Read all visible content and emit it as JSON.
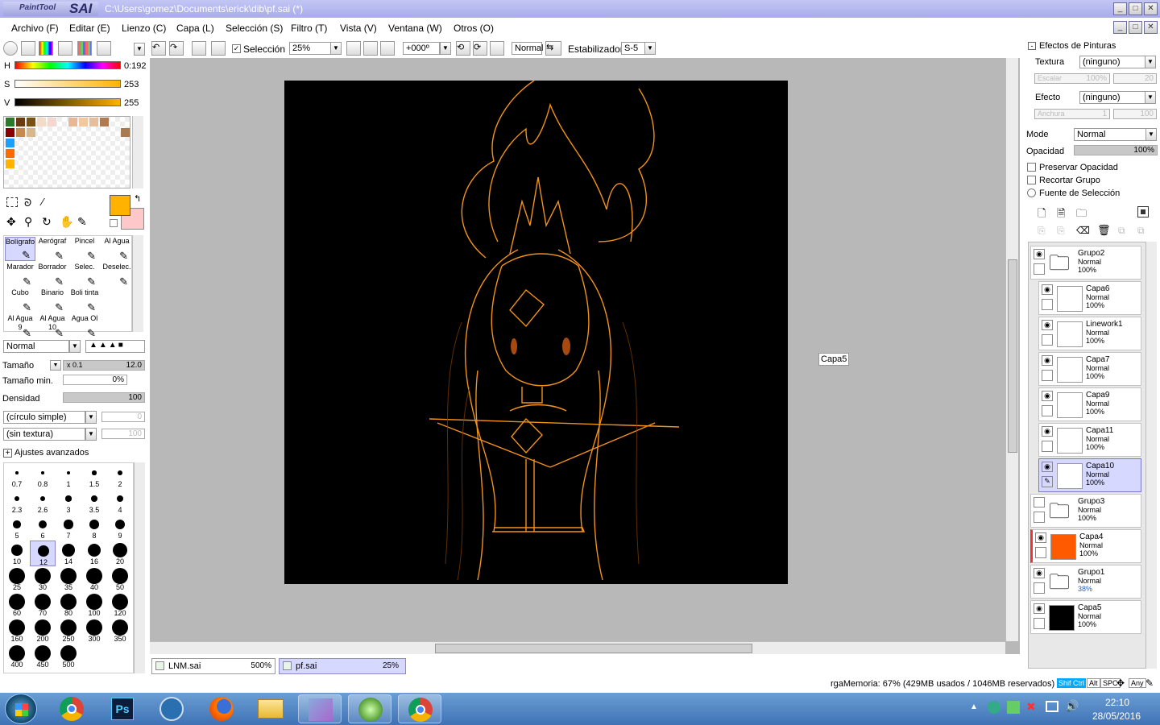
{
  "app": {
    "logo_small": "PaintTool",
    "logo_big": "SAI",
    "window_title": "C:\\Users\\gomez\\Documents\\erick\\dib\\pf.sai (*)"
  },
  "menu": [
    "Archivo (F)",
    "Editar (E)",
    "Lienzo (C)",
    "Capa (L)",
    "Selección (S)",
    "Filtro (T)",
    "Vista (V)",
    "Ventana (W)",
    "Otros (O)"
  ],
  "toolbar": {
    "selection_label": "Selección",
    "zoom": "25%",
    "angle": "+000º",
    "blend": "Normal",
    "stabilizer_label": "Estabilizador",
    "stabilizer_value": "S-5"
  },
  "color": {
    "h_label": "H",
    "h_value": "0:192",
    "s_label": "S",
    "s_value": "253",
    "v_label": "V",
    "v_value": "255",
    "primary": "#ffb300",
    "secondary": "#ffc8c8"
  },
  "tools": [
    {
      "name": "Bolígrafo",
      "selected": true
    },
    {
      "name": "Aerógraf",
      "selected": false
    },
    {
      "name": "Pincel",
      "selected": false
    },
    {
      "name": "Al Agua",
      "selected": false
    },
    {
      "name": "Marador",
      "selected": false
    },
    {
      "name": "Borrador",
      "selected": false
    },
    {
      "name": "Selec.",
      "selected": false
    },
    {
      "name": "Deselec.",
      "selected": false
    },
    {
      "name": "Cubo",
      "selected": false
    },
    {
      "name": "Binario",
      "selected": false
    },
    {
      "name": "Boli tinta",
      "selected": false
    },
    {
      "name": "",
      "selected": false
    },
    {
      "name": "Al Agua 9",
      "selected": false
    },
    {
      "name": "Al Agua 10",
      "selected": false
    },
    {
      "name": "Agua Ol",
      "selected": false
    },
    {
      "name": "",
      "selected": false
    }
  ],
  "brush": {
    "mode": "Normal",
    "size_label": "Tamaño",
    "size_mult": "x 0.1",
    "size_value": "12.0",
    "min_size_label": "Tamaño min.",
    "min_size_value": "0%",
    "density_label": "Densidad",
    "density_value": "100",
    "shape": "(círculo simple)",
    "shape_value": "0",
    "texture": "(sin textura)",
    "texture_value": "100",
    "advanced_label": "Ajustes avanzados"
  },
  "brush_sizes": [
    "0.7",
    "0.8",
    "1",
    "1.5",
    "2",
    "2.3",
    "2.6",
    "3",
    "3.5",
    "4",
    "5",
    "6",
    "7",
    "8",
    "9",
    "10",
    "12",
    "14",
    "16",
    "20",
    "25",
    "30",
    "35",
    "40",
    "50",
    "60",
    "70",
    "80",
    "100",
    "120",
    "160",
    "200",
    "250",
    "300",
    "350",
    "400",
    "450",
    "500"
  ],
  "canvas": {
    "floating_label": "Capa5",
    "tabs": [
      {
        "name": "LNM.sai",
        "zoom": "500%"
      },
      {
        "name": "pf.sai",
        "zoom": "25%"
      }
    ]
  },
  "effects": {
    "title": "Efectos de Pinturas",
    "texture_label": "Textura",
    "texture_value": "(ninguno)",
    "scale_label": "Escalar",
    "scale_value": "100%",
    "scale_num": "20",
    "effect_label": "Efecto",
    "effect_value": "(ninguno)",
    "width_label": "Anchura",
    "width_value": "1",
    "width_num": "100"
  },
  "layer_props": {
    "mode_label": "Mode",
    "mode_value": "Normal",
    "opacity_label": "Opacidad",
    "opacity_value": "100%",
    "preserve_label": "Preservar Opacidad",
    "clip_label": "Recortar Grupo",
    "selsource_label": "Fuente de Selección"
  },
  "layers": [
    {
      "name": "Grupo2",
      "mode": "Normal",
      "opacity": "100%",
      "folder": true,
      "indent": false,
      "visible": true,
      "selected": false,
      "thumb": "#ffffff"
    },
    {
      "name": "Capa6",
      "mode": "Normal",
      "opacity": "100%",
      "folder": false,
      "indent": true,
      "visible": true,
      "selected": false,
      "thumb": "#ffffff"
    },
    {
      "name": "Linework1",
      "mode": "Normal",
      "opacity": "100%",
      "folder": false,
      "indent": true,
      "visible": true,
      "selected": false,
      "thumb": "#ffffff"
    },
    {
      "name": "Capa7",
      "mode": "Normal",
      "opacity": "100%",
      "folder": false,
      "indent": true,
      "visible": true,
      "selected": false,
      "thumb": "#ffffff"
    },
    {
      "name": "Capa9",
      "mode": "Normal",
      "opacity": "100%",
      "folder": false,
      "indent": true,
      "visible": true,
      "selected": false,
      "thumb": "#ffffff"
    },
    {
      "name": "Capa11",
      "mode": "Normal",
      "opacity": "100%",
      "folder": false,
      "indent": true,
      "visible": true,
      "selected": false,
      "thumb": "#ffffff"
    },
    {
      "name": "Capa10",
      "mode": "Normal",
      "opacity": "100%",
      "folder": false,
      "indent": true,
      "visible": true,
      "selected": true,
      "thumb": "#ffffff"
    },
    {
      "name": "Grupo3",
      "mode": "Normal",
      "opacity": "100%",
      "folder": true,
      "indent": false,
      "visible": false,
      "selected": false,
      "thumb": "#ffffff"
    },
    {
      "name": "Capa4",
      "mode": "Normal",
      "opacity": "100%",
      "folder": false,
      "indent": false,
      "visible": true,
      "selected": false,
      "thumb": "#ff5a00"
    },
    {
      "name": "Grupo1",
      "mode": "Normal",
      "opacity": "38%",
      "folder": true,
      "indent": false,
      "visible": true,
      "selected": false,
      "thumb": "#ffffff"
    },
    {
      "name": "Capa5",
      "mode": "Normal",
      "opacity": "100%",
      "folder": false,
      "indent": false,
      "visible": true,
      "selected": false,
      "thumb": "#000000"
    }
  ],
  "status": {
    "memory": "rgaMemoria: 67% (429MB usados / 1046MB reservados)",
    "keys": [
      "Shift",
      "Ctrl",
      "Alt",
      "SPC",
      "Any"
    ]
  },
  "taskbar": {
    "time": "22:10",
    "date": "28/05/2016"
  }
}
